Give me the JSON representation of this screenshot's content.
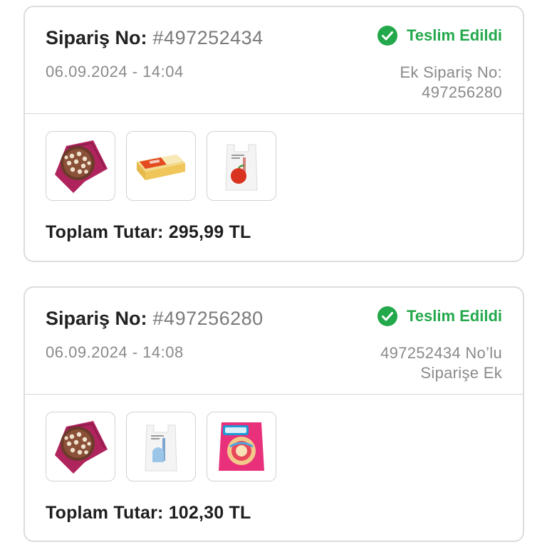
{
  "colors": {
    "status_green": "#23a84b",
    "border": "#dcdcdc",
    "muted": "#8a8a8a"
  },
  "orders": [
    {
      "order_label": "Sipariş No:",
      "order_number": "#497252434",
      "date": "06.09.2024 - 14:04",
      "status": "Teslim Edildi",
      "status_icon": "check-circle-icon",
      "extra_line1": "Ek Sipariş No:",
      "extra_line2": "497256280",
      "products": [
        "chocolate-biscuit-bowl",
        "butter-block",
        "shopping-bag-red"
      ],
      "total": "Toplam Tutar: 295,99 TL"
    },
    {
      "order_label": "Sipariş No:",
      "order_number": "#497256280",
      "date": "06.09.2024 - 14:08",
      "status": "Teslim Edildi",
      "status_icon": "check-circle-icon",
      "extra_line1": "497252434 No’lu",
      "extra_line2": "Siparişe Ek",
      "products": [
        "chocolate-biscuit-bowl",
        "shopping-bag-blue",
        "kekstra-cake-pack"
      ],
      "total": "Toplam Tutar: 102,30 TL"
    }
  ]
}
